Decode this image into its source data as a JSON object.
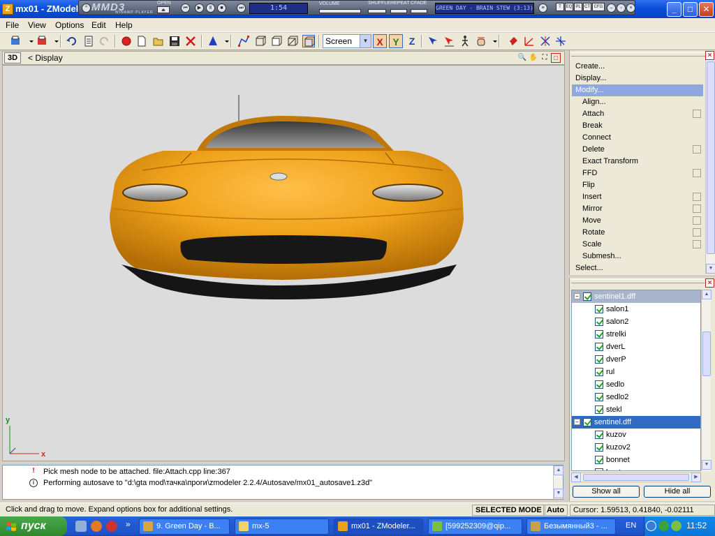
{
  "window": {
    "title": "mx01 - ZModeler"
  },
  "winamp": {
    "logo": "MMD3",
    "logo_sub": "WINAMP·PLAYER",
    "open_label": "OPEN",
    "time": "1:54",
    "volume_label": "VOLUME",
    "shuffle_label": "SHUFFLE",
    "repeat_label": "REPEAT",
    "crossfade_label": "CFADE",
    "track": "GREEN DAY - BRAIN STEW (3:13)",
    "mini_buttons": [
      "T",
      "EQ",
      "PL",
      "CT",
      "CFG"
    ]
  },
  "menu": {
    "items": [
      "File",
      "View",
      "Options",
      "Edit",
      "Help"
    ]
  },
  "toolbar": {
    "coord_system": "Screen",
    "axis_x": "X",
    "axis_y": "Y",
    "axis_z": "Z"
  },
  "viewport": {
    "mode_button": "3D",
    "breadcrumb": "< Display",
    "axis_y_label": "y",
    "axis_x_label": "x",
    "colors": {
      "car_body": "#f0a21a",
      "background": "#dcdcdc"
    }
  },
  "modifier_panel": {
    "items": [
      {
        "label": "Create...",
        "indent": false,
        "selected": false,
        "options_box": false
      },
      {
        "label": "Display...",
        "indent": false,
        "selected": false,
        "options_box": false
      },
      {
        "label": "Modify...",
        "indent": false,
        "selected": true,
        "options_box": false
      },
      {
        "label": "Align...",
        "indent": true,
        "selected": false,
        "options_box": false
      },
      {
        "label": "Attach",
        "indent": true,
        "selected": false,
        "options_box": true
      },
      {
        "label": "Break",
        "indent": true,
        "selected": false,
        "options_box": false
      },
      {
        "label": "Connect",
        "indent": true,
        "selected": false,
        "options_box": false
      },
      {
        "label": "Delete",
        "indent": true,
        "selected": false,
        "options_box": true
      },
      {
        "label": "Exact Transform",
        "indent": true,
        "selected": false,
        "options_box": false
      },
      {
        "label": "FFD",
        "indent": true,
        "selected": false,
        "options_box": true
      },
      {
        "label": "Flip",
        "indent": true,
        "selected": false,
        "options_box": false
      },
      {
        "label": "Insert",
        "indent": true,
        "selected": false,
        "options_box": true
      },
      {
        "label": "Mirror",
        "indent": true,
        "selected": false,
        "options_box": true
      },
      {
        "label": "Move",
        "indent": true,
        "selected": false,
        "options_box": true
      },
      {
        "label": "Rotate",
        "indent": true,
        "selected": false,
        "options_box": true
      },
      {
        "label": "Scale",
        "indent": true,
        "selected": false,
        "options_box": true
      },
      {
        "label": "Submesh...",
        "indent": true,
        "selected": false,
        "options_box": false
      },
      {
        "label": "Select...",
        "indent": false,
        "selected": false,
        "options_box": false
      }
    ]
  },
  "hierarchy_panel": {
    "rows": [
      {
        "label": "sentinel1.dff",
        "level": 0,
        "header": true,
        "active": false
      },
      {
        "label": "salon1",
        "level": 1,
        "header": false,
        "active": false
      },
      {
        "label": "salon2",
        "level": 1,
        "header": false,
        "active": false
      },
      {
        "label": "strelki",
        "level": 1,
        "header": false,
        "active": false
      },
      {
        "label": "dverL",
        "level": 1,
        "header": false,
        "active": false
      },
      {
        "label": "dverP",
        "level": 1,
        "header": false,
        "active": false
      },
      {
        "label": "rul",
        "level": 1,
        "header": false,
        "active": false
      },
      {
        "label": "sedlo",
        "level": 1,
        "header": false,
        "active": false
      },
      {
        "label": "sedlo2",
        "level": 1,
        "header": false,
        "active": false
      },
      {
        "label": "stekl",
        "level": 1,
        "header": false,
        "active": false
      },
      {
        "label": "sentinel.dff",
        "level": 0,
        "header": true,
        "active": true
      },
      {
        "label": "kuzov",
        "level": 1,
        "header": false,
        "active": false
      },
      {
        "label": "kuzov2",
        "level": 1,
        "header": false,
        "active": false
      },
      {
        "label": "bonnet",
        "level": 1,
        "header": false,
        "active": false
      },
      {
        "label": "boot",
        "level": 1,
        "header": false,
        "active": false
      }
    ],
    "show_all": "Show all",
    "hide_all": "Hide all"
  },
  "log": {
    "lines": [
      {
        "icon": "warning-icon",
        "text": "Pick mesh node to be attached. file:Attach.cpp line:367"
      },
      {
        "icon": "info-icon",
        "text": "Performing autosave to \"d:\\gta mod\\тачка\\проги\\zmodeler 2.2.4/Autosave/mx01_autosave1.z3d\""
      }
    ]
  },
  "statusbar": {
    "hint": "Click and drag to move. Expand options box for additional settings.",
    "mode": "SELECTED MODE",
    "auto": "Auto",
    "cursor": "Cursor: 1.59513, 0.41840, -0.02111"
  },
  "taskbar": {
    "start_label": "пуск",
    "tasks": [
      {
        "label": "9. Green Day - B...",
        "active": false,
        "icon_color": "#d8a640"
      },
      {
        "label": "mx-5",
        "active": false,
        "icon_color": "#f2d36b"
      },
      {
        "label": "mx01 - ZModeler...",
        "active": true,
        "icon_color": "#e8a31a"
      },
      {
        "label": "[599252309@qip...",
        "active": false,
        "icon_color": "#7bc043"
      },
      {
        "label": "Безымянный3 - ...",
        "active": false,
        "icon_color": "#c9a04a"
      }
    ],
    "language": "EN",
    "clock": "11:52"
  }
}
